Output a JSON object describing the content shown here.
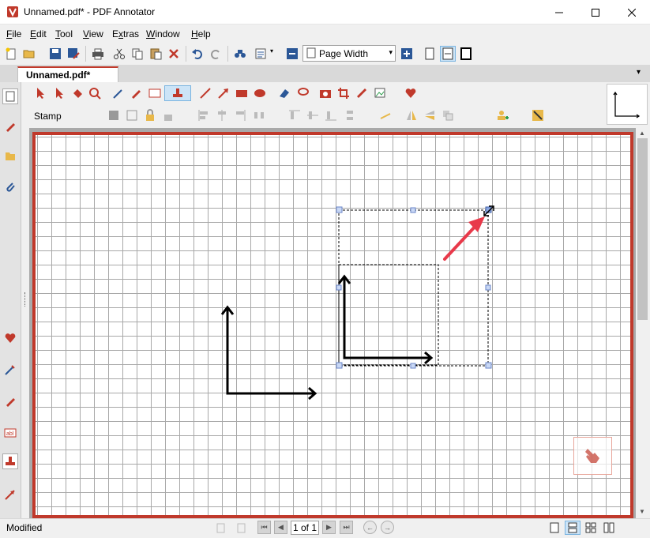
{
  "window": {
    "title": "Unnamed.pdf* - PDF Annotator"
  },
  "menu": [
    "File",
    "Edit",
    "Tool",
    "View",
    "Extras",
    "Window",
    "Help"
  ],
  "menu_underline": [
    "F",
    "E",
    "T",
    "V",
    "x",
    "W",
    "H"
  ],
  "toolbar": {
    "zoom_value": "Page Width"
  },
  "tab": {
    "label": "Unnamed.pdf*"
  },
  "toolbox": {
    "current_tool_label": "Stamp"
  },
  "status": {
    "text": "Modified",
    "page_field": "1 of 1"
  },
  "colors": {
    "accent": "#c0392b",
    "grid": "#a8a8a8",
    "arrow": "#e8394a"
  },
  "icons": {
    "toolbar1": [
      "new-document-icon",
      "open-folder-icon",
      "save-icon",
      "save-as-icon",
      "print-icon",
      "cut-icon",
      "copy-icon",
      "paste-icon",
      "delete-icon",
      "undo-icon",
      "redo-icon",
      "find-icon",
      "batch-icon",
      "zoom-out-icon",
      "zoom-in-icon",
      "single-page-icon",
      "fit-width-icon",
      "fullscreen-icon"
    ],
    "left_sidebar": [
      "page-thumbnail-icon",
      "annotation-list-icon",
      "bookmark-icon",
      "attachment-icon",
      "favorite-icon",
      "pen-icon",
      "highlighter-icon",
      "text-icon",
      "stamp-icon",
      "arrow-icon"
    ]
  }
}
